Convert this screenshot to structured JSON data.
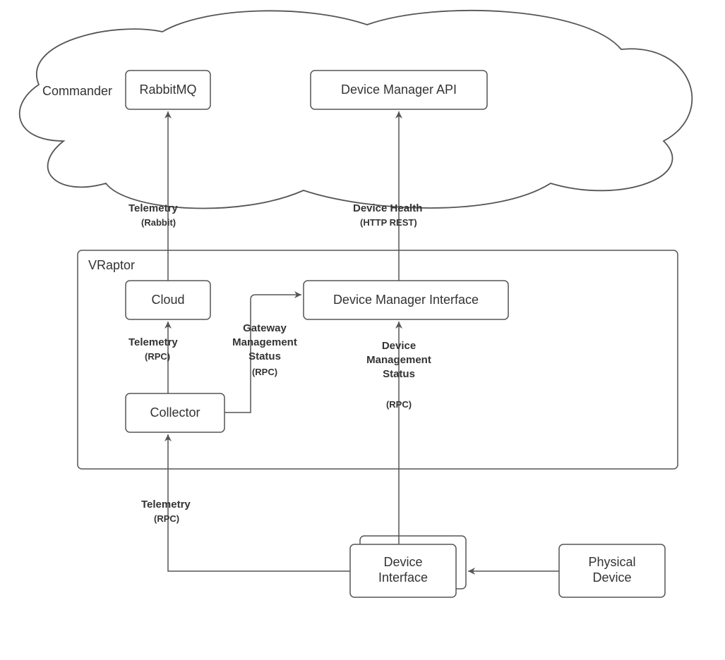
{
  "groups": {
    "commander": {
      "label": "Commander"
    },
    "vraptor": {
      "label": "VRaptor"
    }
  },
  "nodes": {
    "rabbitmq": {
      "label": "RabbitMQ"
    },
    "device_manager_api": {
      "label": "Device Manager API"
    },
    "cloud": {
      "label": "Cloud"
    },
    "device_manager_interface": {
      "label": "Device Manager Interface"
    },
    "collector": {
      "label": "Collector"
    },
    "device_interface_line1": "Device",
    "device_interface_line2": "Interface",
    "physical_device_line1": "Physical",
    "physical_device_line2": "Device"
  },
  "edges": {
    "telemetry_rabbit": {
      "title": "Telemetry",
      "sub": "(Rabbit)"
    },
    "device_health": {
      "title": "Device Health",
      "sub": "(HTTP REST)"
    },
    "telemetry_rpc1": {
      "title": "Telemetry",
      "sub": "(RPC)"
    },
    "telemetry_rpc2": {
      "title": "Telemetry",
      "sub": "(RPC)"
    },
    "gateway_mgmt_l1": "Gateway",
    "gateway_mgmt_l2": "Management",
    "gateway_mgmt_l3": "Status",
    "gateway_mgmt_sub": "(RPC)",
    "device_mgmt_l1": "Device",
    "device_mgmt_l2": "Management",
    "device_mgmt_l3": "Status",
    "device_mgmt_sub": "(RPC)"
  }
}
